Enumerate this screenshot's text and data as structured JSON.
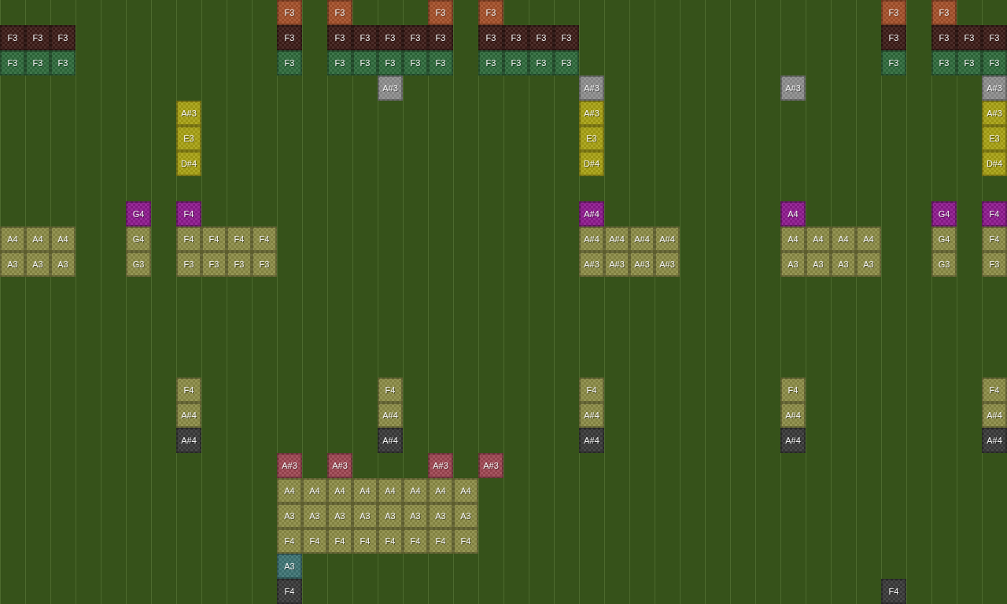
{
  "rows": [
    [
      null,
      null,
      null,
      null,
      null,
      null,
      null,
      null,
      null,
      null,
      null,
      {
        "label": "F3",
        "color": "#a5502a"
      },
      null,
      {
        "label": "F3",
        "color": "#a5502a"
      },
      null,
      null,
      null,
      {
        "label": "F3",
        "color": "#a5502a"
      },
      null,
      {
        "label": "F3",
        "color": "#a5502a"
      },
      null,
      null,
      null,
      null,
      null,
      null,
      null,
      null,
      null,
      null,
      null,
      null,
      null,
      null,
      null,
      {
        "label": "F3",
        "color": "#a5502a"
      },
      null,
      {
        "label": "F3",
        "color": "#a5502a"
      }
    ],
    [
      {
        "label": "F3",
        "color": "#3d1c18"
      },
      {
        "label": "F3",
        "color": "#3d1c18"
      },
      {
        "label": "F3",
        "color": "#3d1c18"
      },
      null,
      null,
      null,
      null,
      null,
      null,
      null,
      null,
      {
        "label": "F3",
        "color": "#3d1c18"
      },
      null,
      {
        "label": "F3",
        "color": "#3d1c18"
      },
      {
        "label": "F3",
        "color": "#3d1c18"
      },
      {
        "label": "F3",
        "color": "#3d1c18"
      },
      {
        "label": "F3",
        "color": "#3d1c18"
      },
      {
        "label": "F3",
        "color": "#3d1c18"
      },
      null,
      {
        "label": "F3",
        "color": "#3d1c18"
      },
      {
        "label": "F3",
        "color": "#3d1c18"
      },
      {
        "label": "F3",
        "color": "#3d1c18"
      },
      {
        "label": "F3",
        "color": "#3d1c18"
      },
      null,
      null,
      null,
      null,
      null,
      null,
      null,
      null,
      null,
      null,
      null,
      null,
      {
        "label": "F3",
        "color": "#3d1c18"
      },
      null,
      {
        "label": "F3",
        "color": "#3d1c18"
      },
      {
        "label": "F3",
        "color": "#3d1c18"
      },
      {
        "label": "F3",
        "color": "#3d1c18"
      }
    ],
    [
      {
        "label": "F3",
        "color": "#2f6a3c"
      },
      {
        "label": "F3",
        "color": "#2f6a3c"
      },
      {
        "label": "F3",
        "color": "#2f6a3c"
      },
      null,
      null,
      null,
      null,
      null,
      null,
      null,
      null,
      {
        "label": "F3",
        "color": "#2f6a3c"
      },
      null,
      {
        "label": "F3",
        "color": "#2f6a3c"
      },
      {
        "label": "F3",
        "color": "#2f6a3c"
      },
      {
        "label": "F3",
        "color": "#2f6a3c"
      },
      {
        "label": "F3",
        "color": "#2f6a3c"
      },
      {
        "label": "F3",
        "color": "#2f6a3c"
      },
      null,
      {
        "label": "F3",
        "color": "#2f6a3c"
      },
      {
        "label": "F3",
        "color": "#2f6a3c"
      },
      {
        "label": "F3",
        "color": "#2f6a3c"
      },
      {
        "label": "F3",
        "color": "#2f6a3c"
      },
      null,
      null,
      null,
      null,
      null,
      null,
      null,
      null,
      null,
      null,
      null,
      null,
      {
        "label": "F3",
        "color": "#2f6a3c"
      },
      null,
      {
        "label": "F3",
        "color": "#2f6a3c"
      },
      {
        "label": "F3",
        "color": "#2f6a3c"
      },
      {
        "label": "F3",
        "color": "#2f6a3c"
      }
    ],
    [
      null,
      null,
      null,
      null,
      null,
      null,
      null,
      null,
      null,
      null,
      null,
      null,
      null,
      null,
      null,
      {
        "label": "A#3",
        "color": "#8e8e8e"
      },
      null,
      null,
      null,
      null,
      null,
      null,
      null,
      {
        "label": "A#3",
        "color": "#8e8e8e"
      },
      null,
      null,
      null,
      null,
      null,
      null,
      null,
      {
        "label": "A#3",
        "color": "#8e8e8e"
      },
      null,
      null,
      null,
      null,
      null,
      null,
      null,
      {
        "label": "A#3",
        "color": "#8e8e8e"
      }
    ],
    [
      null,
      null,
      null,
      null,
      null,
      null,
      null,
      {
        "label": "A#3",
        "color": "#a8a214"
      },
      null,
      null,
      null,
      null,
      null,
      null,
      null,
      null,
      null,
      null,
      null,
      null,
      null,
      null,
      null,
      {
        "label": "A#3",
        "color": "#a8a214"
      },
      null,
      null,
      null,
      null,
      null,
      null,
      null,
      null,
      null,
      null,
      null,
      null,
      null,
      null,
      null,
      {
        "label": "A#3",
        "color": "#a8a214"
      }
    ],
    [
      null,
      null,
      null,
      null,
      null,
      null,
      null,
      {
        "label": "E3",
        "color": "#a8a214"
      },
      null,
      null,
      null,
      null,
      null,
      null,
      null,
      null,
      null,
      null,
      null,
      null,
      null,
      null,
      null,
      {
        "label": "E3",
        "color": "#a8a214"
      },
      null,
      null,
      null,
      null,
      null,
      null,
      null,
      null,
      null,
      null,
      null,
      null,
      null,
      null,
      null,
      {
        "label": "E3",
        "color": "#a8a214"
      }
    ],
    [
      null,
      null,
      null,
      null,
      null,
      null,
      null,
      {
        "label": "D#4",
        "color": "#a8a214"
      },
      null,
      null,
      null,
      null,
      null,
      null,
      null,
      null,
      null,
      null,
      null,
      null,
      null,
      null,
      null,
      {
        "label": "D#4",
        "color": "#a8a214"
      },
      null,
      null,
      null,
      null,
      null,
      null,
      null,
      null,
      null,
      null,
      null,
      null,
      null,
      null,
      null,
      {
        "label": "D#4",
        "color": "#a8a214"
      }
    ],
    [],
    [
      null,
      null,
      null,
      null,
      null,
      {
        "label": "G4",
        "color": "#8e1a8e"
      },
      null,
      {
        "label": "F4",
        "color": "#8e1a8e"
      },
      null,
      null,
      null,
      null,
      null,
      null,
      null,
      null,
      null,
      null,
      null,
      null,
      null,
      null,
      null,
      {
        "label": "A#4",
        "color": "#8e1a8e"
      },
      null,
      null,
      null,
      null,
      null,
      null,
      null,
      {
        "label": "A4",
        "color": "#8e1a8e"
      },
      null,
      null,
      null,
      null,
      null,
      {
        "label": "G4",
        "color": "#8e1a8e"
      },
      null,
      {
        "label": "F4",
        "color": "#8e1a8e"
      }
    ],
    [
      {
        "label": "A4",
        "color": "#8c8c46"
      },
      {
        "label": "A4",
        "color": "#8c8c46"
      },
      {
        "label": "A4",
        "color": "#8c8c46"
      },
      null,
      null,
      {
        "label": "G4",
        "color": "#8c8c46"
      },
      null,
      {
        "label": "F4",
        "color": "#8c8c46"
      },
      {
        "label": "F4",
        "color": "#8c8c46"
      },
      {
        "label": "F4",
        "color": "#8c8c46"
      },
      {
        "label": "F4",
        "color": "#8c8c46"
      },
      null,
      null,
      null,
      null,
      null,
      null,
      null,
      null,
      null,
      null,
      null,
      null,
      {
        "label": "A#4",
        "color": "#8c8c46"
      },
      {
        "label": "A#4",
        "color": "#8c8c46"
      },
      {
        "label": "A#4",
        "color": "#8c8c46"
      },
      {
        "label": "A#4",
        "color": "#8c8c46"
      },
      null,
      null,
      null,
      null,
      {
        "label": "A4",
        "color": "#8c8c46"
      },
      {
        "label": "A4",
        "color": "#8c8c46"
      },
      {
        "label": "A4",
        "color": "#8c8c46"
      },
      {
        "label": "A4",
        "color": "#8c8c46"
      },
      null,
      null,
      {
        "label": "G4",
        "color": "#8c8c46"
      },
      null,
      {
        "label": "F4",
        "color": "#8c8c46"
      }
    ],
    [
      {
        "label": "A3",
        "color": "#8c8c46"
      },
      {
        "label": "A3",
        "color": "#8c8c46"
      },
      {
        "label": "A3",
        "color": "#8c8c46"
      },
      null,
      null,
      {
        "label": "G3",
        "color": "#8c8c46"
      },
      null,
      {
        "label": "F3",
        "color": "#8c8c46"
      },
      {
        "label": "F3",
        "color": "#8c8c46"
      },
      {
        "label": "F3",
        "color": "#8c8c46"
      },
      {
        "label": "F3",
        "color": "#8c8c46"
      },
      null,
      null,
      null,
      null,
      null,
      null,
      null,
      null,
      null,
      null,
      null,
      null,
      {
        "label": "A#3",
        "color": "#8c8c46"
      },
      {
        "label": "A#3",
        "color": "#8c8c46"
      },
      {
        "label": "A#3",
        "color": "#8c8c46"
      },
      {
        "label": "A#3",
        "color": "#8c8c46"
      },
      null,
      null,
      null,
      null,
      {
        "label": "A3",
        "color": "#8c8c46"
      },
      {
        "label": "A3",
        "color": "#8c8c46"
      },
      {
        "label": "A3",
        "color": "#8c8c46"
      },
      {
        "label": "A3",
        "color": "#8c8c46"
      },
      null,
      null,
      {
        "label": "G3",
        "color": "#8c8c46"
      },
      null,
      {
        "label": "F3",
        "color": "#8c8c46"
      }
    ],
    [],
    [],
    [],
    [],
    [
      null,
      null,
      null,
      null,
      null,
      null,
      null,
      {
        "label": "F4",
        "color": "#8c8c46"
      },
      null,
      null,
      null,
      null,
      null,
      null,
      null,
      {
        "label": "F4",
        "color": "#8c8c46"
      },
      null,
      null,
      null,
      null,
      null,
      null,
      null,
      {
        "label": "F4",
        "color": "#8c8c46"
      },
      null,
      null,
      null,
      null,
      null,
      null,
      null,
      {
        "label": "F4",
        "color": "#8c8c46"
      },
      null,
      null,
      null,
      null,
      null,
      null,
      null,
      {
        "label": "F4",
        "color": "#8c8c46"
      }
    ],
    [
      null,
      null,
      null,
      null,
      null,
      null,
      null,
      {
        "label": "A#4",
        "color": "#8c8c46"
      },
      null,
      null,
      null,
      null,
      null,
      null,
      null,
      {
        "label": "A#4",
        "color": "#8c8c46"
      },
      null,
      null,
      null,
      null,
      null,
      null,
      null,
      {
        "label": "A#4",
        "color": "#8c8c46"
      },
      null,
      null,
      null,
      null,
      null,
      null,
      null,
      {
        "label": "A#4",
        "color": "#8c8c46"
      },
      null,
      null,
      null,
      null,
      null,
      null,
      null,
      {
        "label": "A#4",
        "color": "#8c8c46"
      }
    ],
    [
      null,
      null,
      null,
      null,
      null,
      null,
      null,
      {
        "label": "A#4",
        "color": "#3a3a3a"
      },
      null,
      null,
      null,
      null,
      null,
      null,
      null,
      {
        "label": "A#4",
        "color": "#3a3a3a"
      },
      null,
      null,
      null,
      null,
      null,
      null,
      null,
      {
        "label": "A#4",
        "color": "#3a3a3a"
      },
      null,
      null,
      null,
      null,
      null,
      null,
      null,
      {
        "label": "A#4",
        "color": "#3a3a3a"
      },
      null,
      null,
      null,
      null,
      null,
      null,
      null,
      {
        "label": "A#4",
        "color": "#3a3a3a"
      }
    ],
    [
      null,
      null,
      null,
      null,
      null,
      null,
      null,
      null,
      null,
      null,
      null,
      {
        "label": "A#3",
        "color": "#9e4652"
      },
      null,
      {
        "label": "A#3",
        "color": "#9e4652"
      },
      null,
      null,
      null,
      {
        "label": "A#3",
        "color": "#9e4652"
      },
      null,
      {
        "label": "A#3",
        "color": "#9e4652"
      }
    ],
    [
      null,
      null,
      null,
      null,
      null,
      null,
      null,
      null,
      null,
      null,
      null,
      {
        "label": "A4",
        "color": "#8c8c46"
      },
      {
        "label": "A4",
        "color": "#8c8c46"
      },
      {
        "label": "A4",
        "color": "#8c8c46"
      },
      {
        "label": "A4",
        "color": "#8c8c46"
      },
      {
        "label": "A4",
        "color": "#8c8c46"
      },
      {
        "label": "A4",
        "color": "#8c8c46"
      },
      {
        "label": "A4",
        "color": "#8c8c46"
      },
      {
        "label": "A4",
        "color": "#8c8c46"
      }
    ],
    [
      null,
      null,
      null,
      null,
      null,
      null,
      null,
      null,
      null,
      null,
      null,
      {
        "label": "A3",
        "color": "#8c8c46"
      },
      {
        "label": "A3",
        "color": "#8c8c46"
      },
      {
        "label": "A3",
        "color": "#8c8c46"
      },
      {
        "label": "A3",
        "color": "#8c8c46"
      },
      {
        "label": "A3",
        "color": "#8c8c46"
      },
      {
        "label": "A3",
        "color": "#8c8c46"
      },
      {
        "label": "A3",
        "color": "#8c8c46"
      },
      {
        "label": "A3",
        "color": "#8c8c46"
      }
    ],
    [
      null,
      null,
      null,
      null,
      null,
      null,
      null,
      null,
      null,
      null,
      null,
      {
        "label": "F4",
        "color": "#8c8c46"
      },
      {
        "label": "F4",
        "color": "#8c8c46"
      },
      {
        "label": "F4",
        "color": "#8c8c46"
      },
      {
        "label": "F4",
        "color": "#8c8c46"
      },
      {
        "label": "F4",
        "color": "#8c8c46"
      },
      {
        "label": "F4",
        "color": "#8c8c46"
      },
      {
        "label": "F4",
        "color": "#8c8c46"
      },
      {
        "label": "F4",
        "color": "#8c8c46"
      }
    ],
    [
      null,
      null,
      null,
      null,
      null,
      null,
      null,
      null,
      null,
      null,
      null,
      {
        "label": "A3",
        "color": "#3e7474"
      }
    ],
    [
      null,
      null,
      null,
      null,
      null,
      null,
      null,
      null,
      null,
      null,
      null,
      {
        "label": "F4",
        "color": "#3a3a3a"
      },
      null,
      null,
      null,
      null,
      null,
      null,
      null,
      null,
      null,
      null,
      null,
      null,
      null,
      null,
      null,
      null,
      null,
      null,
      null,
      null,
      null,
      null,
      null,
      {
        "label": "F4",
        "color": "#3a3a3a"
      }
    ]
  ]
}
